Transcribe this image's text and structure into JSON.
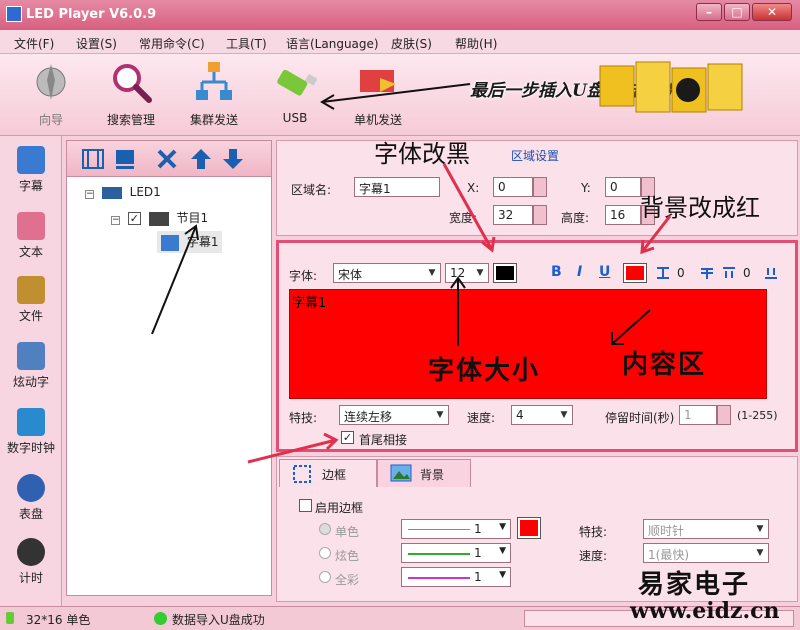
{
  "window": {
    "title": "LED Player V6.0.9"
  },
  "menu": [
    "文件(F)",
    "设置(S)",
    "常用命令(C)",
    "工具(T)",
    "语言(Language)",
    "皮肤(S)",
    "帮助(H)"
  ],
  "toolbar": {
    "items": [
      {
        "label": "向导"
      },
      {
        "label": "搜索管理"
      },
      {
        "label": "集群发送"
      },
      {
        "label": "USB"
      },
      {
        "label": "单机发送"
      }
    ]
  },
  "banner": {
    "note": "最后一步插入U盘点击导出"
  },
  "nav": [
    "字幕",
    "文本",
    "文件",
    "炫动字",
    "数字时钟",
    "表盘",
    "计时"
  ],
  "tree": {
    "root": "LED1",
    "program": "节目1",
    "item": "字幕1"
  },
  "area": {
    "section_title": "区域设置",
    "name_label": "区域名:",
    "name_value": "字幕1",
    "x_label": "X:",
    "x_value": "0",
    "y_label": "Y:",
    "y_value": "0",
    "width_label": "宽度:",
    "width_value": "32",
    "height_label": "高度:",
    "height_value": "16"
  },
  "editor": {
    "font_label": "字体:",
    "font_value": "宋体",
    "size_value": "12",
    "bold": "B",
    "italic": "I",
    "underline": "U",
    "spacing1": "0",
    "spacing2": "0",
    "content_text": "字幕1",
    "effect_label": "特技:",
    "effect_value": "连续左移",
    "speed_label": "速度:",
    "speed_value": "4",
    "stay_label": "停留时间(秒)",
    "stay_value": "1",
    "stay_range": "(1-255)",
    "loop_label": "首尾相接",
    "text_color": "#000000",
    "bg_color": "#ff0000"
  },
  "bottom": {
    "tab_border": "边框",
    "tab_background": "背景",
    "enable_border": "启用边框",
    "mono": "单色",
    "colorful": "炫色",
    "fullcolor": "全彩",
    "line1": "1",
    "line2": "1",
    "line3": "1",
    "effect_label": "特技:",
    "effect_value": "顺时针",
    "speed_label": "速度:",
    "speed_value": "1(最快)"
  },
  "status": {
    "size": "32*16 单色",
    "message": "数据导入U盘成功"
  },
  "annotations": {
    "font_black": "字体改黑",
    "bg_red": "背景改成红",
    "font_size": "字体大小",
    "content_area": "内容区",
    "watermark_cn": "易家电子",
    "watermark_url": "www.eidz.cn"
  }
}
